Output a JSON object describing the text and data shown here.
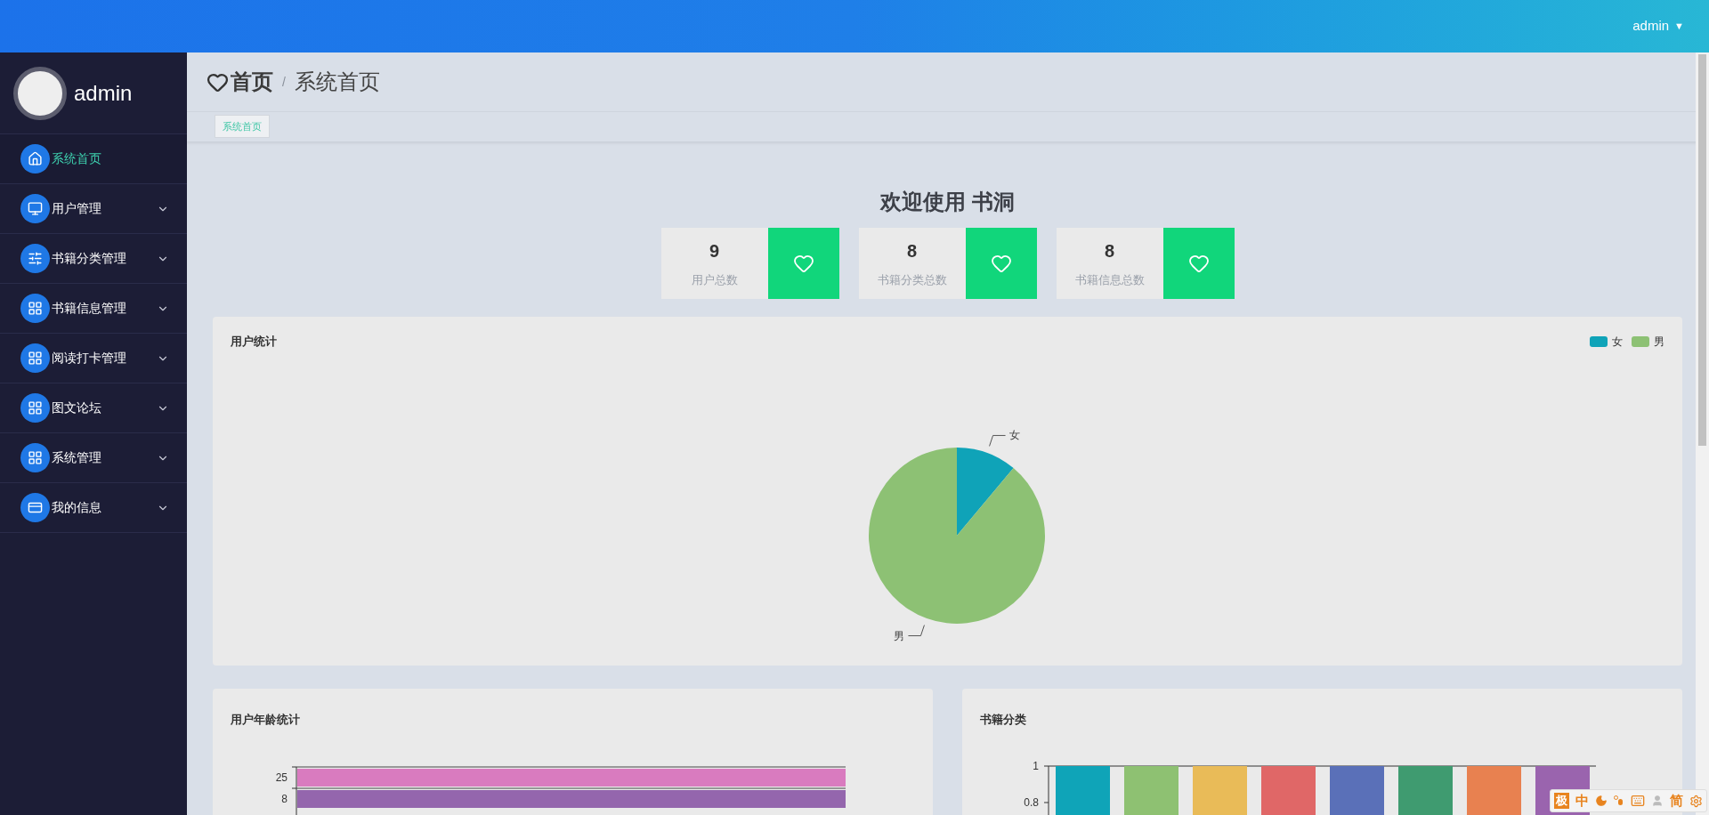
{
  "topbar": {
    "user": "admin",
    "caret": "▼"
  },
  "sidebar": {
    "user": "admin",
    "items": [
      {
        "label": "系统首页",
        "selected": true,
        "has_submenu": false
      },
      {
        "label": "用户管理",
        "selected": false,
        "has_submenu": true
      },
      {
        "label": "书籍分类管理",
        "selected": false,
        "has_submenu": true
      },
      {
        "label": "书籍信息管理",
        "selected": false,
        "has_submenu": true
      },
      {
        "label": "阅读打卡管理",
        "selected": false,
        "has_submenu": true
      },
      {
        "label": "图文论坛",
        "selected": false,
        "has_submenu": true
      },
      {
        "label": "系统管理",
        "selected": false,
        "has_submenu": true
      },
      {
        "label": "我的信息",
        "selected": false,
        "has_submenu": true
      }
    ]
  },
  "breadcrumb": {
    "home": "首页",
    "separator": "/",
    "current": "系统首页"
  },
  "tags": [
    {
      "label": "系统首页",
      "selected": true
    }
  ],
  "welcome": "欢迎使用 书洞",
  "stats": [
    {
      "value": "9",
      "label": "用户总数"
    },
    {
      "value": "8",
      "label": "书籍分类总数"
    },
    {
      "value": "8",
      "label": "书籍信息总数"
    }
  ],
  "user_stats": {
    "title": "用户统计",
    "legend": [
      {
        "label": "女",
        "color": "#0fa3b8"
      },
      {
        "label": "男",
        "color": "#8dc174"
      }
    ],
    "chart_data": {
      "type": "pie",
      "categories": [
        "女",
        "男"
      ],
      "values": [
        11.1,
        88.9
      ]
    }
  },
  "age_stats": {
    "title": "用户年龄统计",
    "bars": [
      {
        "label": "25",
        "color": "#d97bbf"
      },
      {
        "label": "8",
        "color": "#9466ad"
      }
    ]
  },
  "book_categories": {
    "title": "书籍分类",
    "chart_data": {
      "type": "bar",
      "values": [
        1,
        1,
        1,
        1,
        1,
        1,
        1,
        1
      ],
      "ylim": [
        0,
        1
      ],
      "yticks": [
        {
          "value": 0.8,
          "label": "0.8"
        },
        {
          "value": 1,
          "label": "1"
        }
      ],
      "colors": [
        "#0fa4b8",
        "#8ec172",
        "#e9bb58",
        "#e06767",
        "#5a70b8",
        "#3f9b70",
        "#e88150",
        "#9a64ae"
      ]
    }
  },
  "ime_bar": {
    "logo": "极",
    "mode": "中",
    "script": "简"
  }
}
